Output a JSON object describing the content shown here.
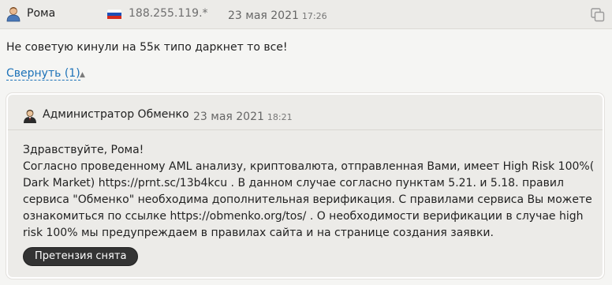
{
  "post": {
    "author": "Рома",
    "ip": "188.255.119.*",
    "date": "23 мая 2021",
    "time": "17:26",
    "message": "Не советую кинули на 55к типо даркнет то все!",
    "collapse_label": "Свернуть (1)",
    "icons": {
      "user": "user-icon",
      "flag": "russia-flag-icon",
      "copy": "copy-icon",
      "caret": "caret-up-icon"
    },
    "flag_colors": [
      "#ffffff",
      "#1c4fb8",
      "#d52b1e"
    ]
  },
  "reply": {
    "author": "Администратор Обменко",
    "date": "23 мая 2021",
    "time": "18:21",
    "greeting": "Здравствуйте, Рома!",
    "text": "Согласно проведенному AML анализу, криптовалюта, отправленная Вами, имеет High Risk 100%( Dark Market) https://prnt.sc/13b4kcu . В данном случае согласно пунктам 5.21. и 5.18. правил сервиса \"Обменко\" необходима дополнительная верификация. С правилами сервиса Вы можете ознакомиться по ссылке https://obmenko.org/tos/ . О необходимости верификации в случае high risk 100% мы предупреждаем в правилах сайта и на странице создания заявки.",
    "button_label": "Претензия снята",
    "icons": {
      "admin": "admin-icon"
    }
  }
}
